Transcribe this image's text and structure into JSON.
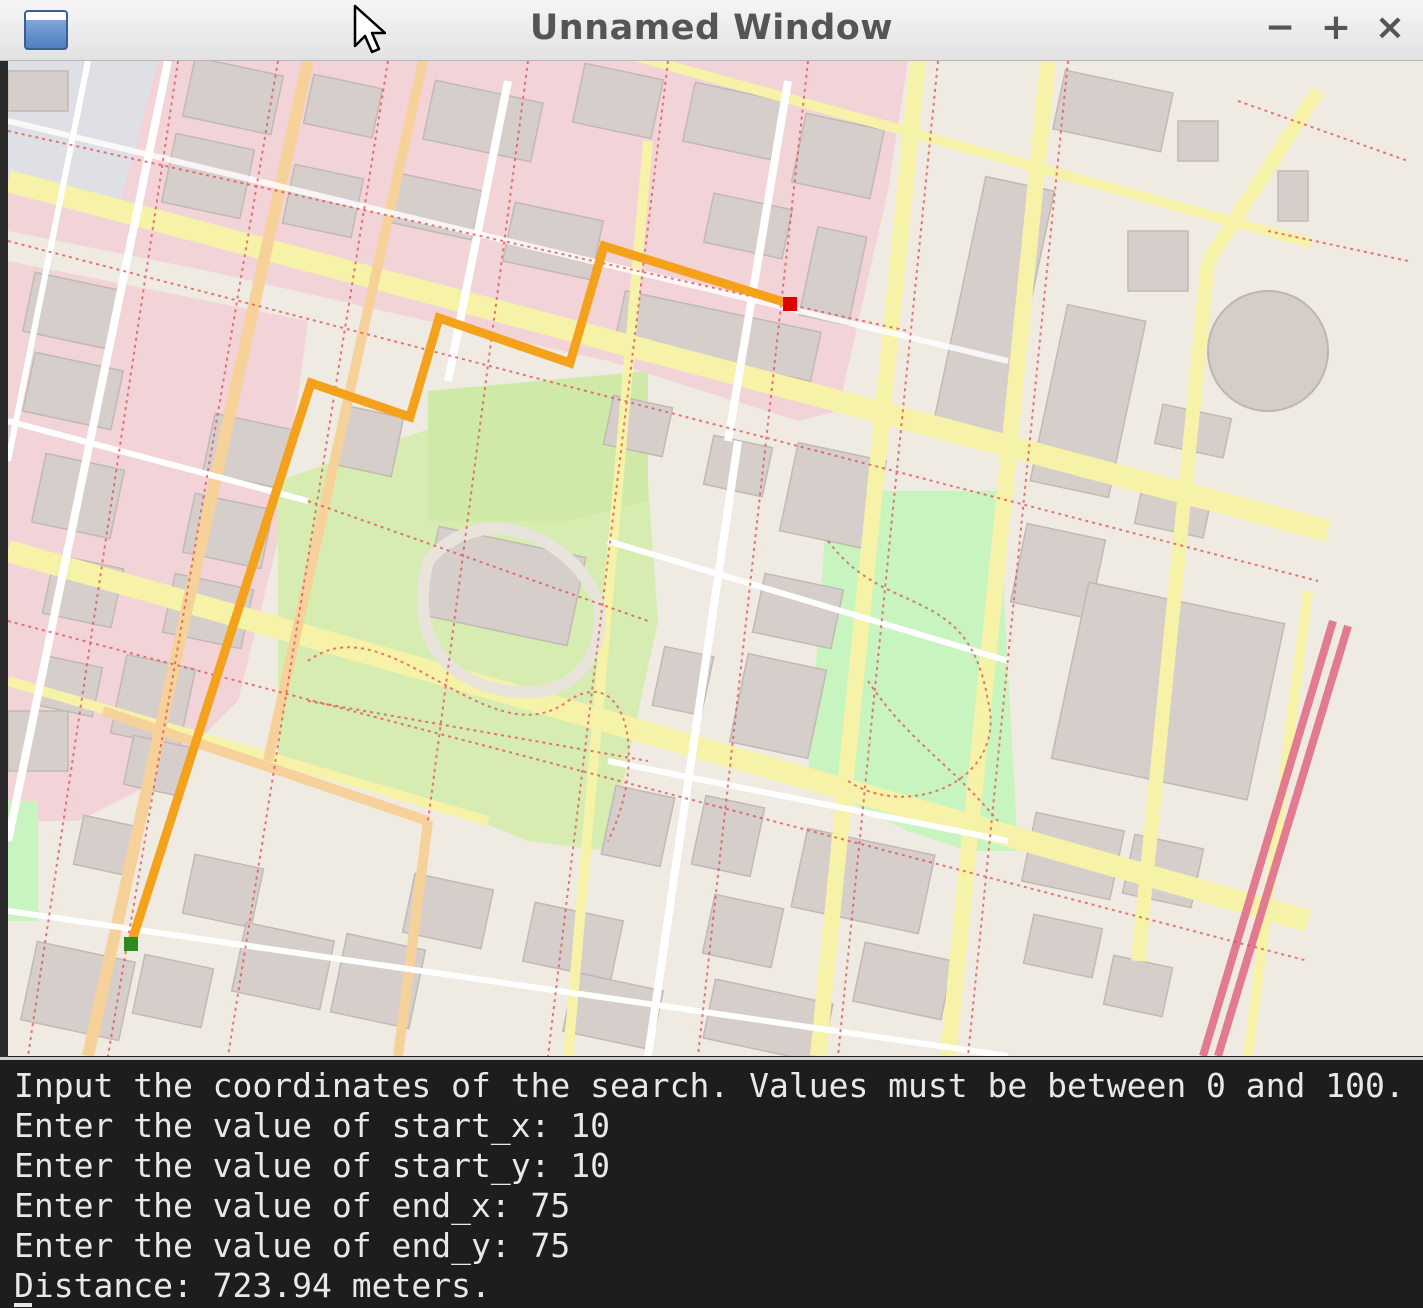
{
  "window": {
    "title": "Unnamed Window",
    "controls": {
      "minimize": "−",
      "maximize": "+",
      "close": "×"
    }
  },
  "map": {
    "route_color": "#f4a21c",
    "start_marker_color": "#2e8b1e",
    "end_marker_color": "#e00000"
  },
  "console": {
    "lines": [
      "Input the coordinates of the search. Values must be between 0 and 100.",
      "Enter the value of start_x: 10",
      "Enter the value of start_y: 10",
      "Enter the value of end_x: 75",
      "Enter the value of end_y: 75",
      "Distance: 723.94 meters."
    ]
  }
}
